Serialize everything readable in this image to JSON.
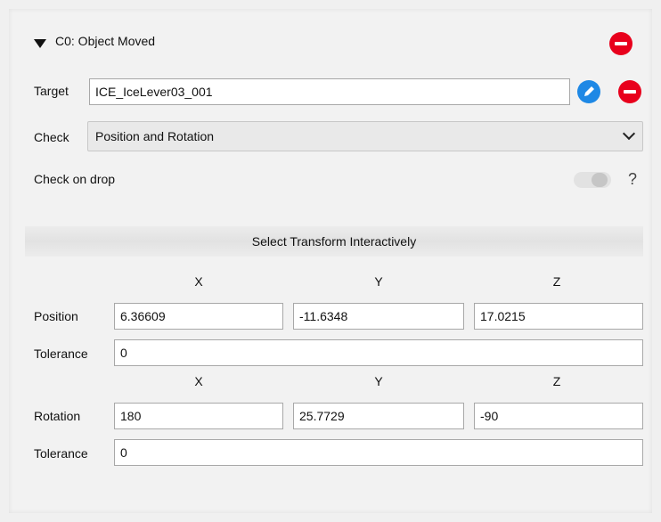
{
  "header": {
    "title": "C0: Object Moved"
  },
  "target": {
    "label": "Target",
    "value": "ICE_IceLever03_001"
  },
  "check": {
    "label": "Check",
    "selected": "Position and Rotation"
  },
  "check_on_drop": {
    "label": "Check on drop",
    "help": "?",
    "enabled": false
  },
  "select_transform": {
    "label": "Select Transform Interactively"
  },
  "axes": {
    "x": "X",
    "y": "Y",
    "z": "Z"
  },
  "position": {
    "label": "Position",
    "x": "6.36609",
    "y": "-11.6348",
    "z": "17.0215"
  },
  "position_tolerance": {
    "label": "Tolerance",
    "value": "0"
  },
  "rotation": {
    "label": "Rotation",
    "x": "180",
    "y": "25.7729",
    "z": "-90"
  },
  "rotation_tolerance": {
    "label": "Tolerance",
    "value": "0"
  },
  "colors": {
    "remove": "#e8001c",
    "edit": "#1e88e5"
  },
  "icons": {
    "collapse": "triangle-down-icon",
    "remove": "minus-circle-icon",
    "edit": "pencil-icon",
    "dropdown": "chevron-down-icon",
    "toggle": "toggle-icon"
  }
}
